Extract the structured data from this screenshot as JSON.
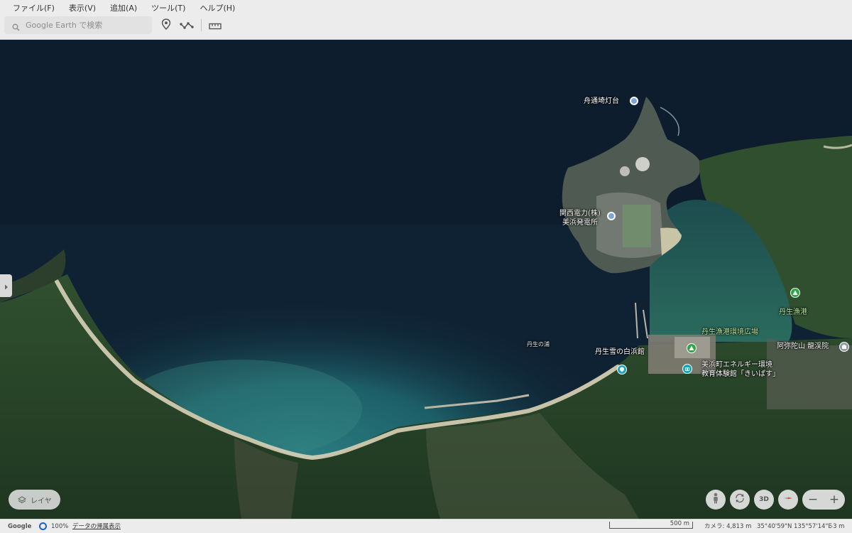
{
  "menu": {
    "file": "ファイル(F)",
    "view": "表示(V)",
    "add": "追加(A)",
    "tools": "ツール(T)",
    "help": "ヘルプ(H)"
  },
  "search": {
    "placeholder": "Google Earth で検索"
  },
  "toolbar_icons": [
    "search-icon",
    "placemark-icon",
    "path-icon",
    "ruler-icon"
  ],
  "places": {
    "lighthouse": "舟通埼灯台",
    "power_plant_line1": "関西電力(株)",
    "power_plant_line2": "美浜発電所",
    "fishing_port": "丹生漁港",
    "fishing_plaza": "丹生漁港環境広場",
    "bay": "丹生の浦",
    "shirahama_hall": "丹生雪の白浜館",
    "temple": "阿弥陀山 龍渓院",
    "energy_center_line1": "美浜町エネルギー環境",
    "energy_center_line2": "教育体験館「きいぱす」"
  },
  "layers_button": {
    "label": "レイヤ"
  },
  "view_controls": {
    "three_d": "3D",
    "zoom_out": "−",
    "zoom_in": "+"
  },
  "status": {
    "brand": "Google",
    "loading": "100%",
    "data_attribution": "データの帰属表示",
    "scale": "500 m",
    "camera": "カメラ: 4,813 m",
    "coordinates": "35°40'59\"N 135°57'14\"E",
    "elevation": "-3 m"
  },
  "colors": {
    "deep_sea": "#0f2233",
    "shallow_water": "#1f6a70",
    "beach": "#d9d2b8",
    "forest": "#27412a",
    "chrome": "#ececec",
    "pin_green": "#2fa546",
    "pin_teal": "#1aa5b8"
  }
}
